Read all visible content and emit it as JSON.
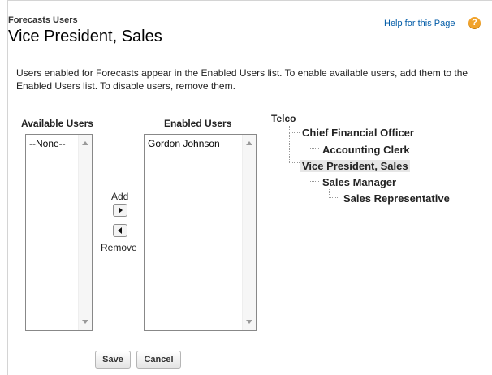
{
  "header": {
    "eyebrow": "Forecasts Users",
    "title": "Vice President, Sales",
    "help_link": "Help for this Page",
    "help_icon": "help-icon"
  },
  "description": "Users enabled for Forecasts appear in the Enabled Users list. To enable available users, add them to the Enabled Users list. To disable users, remove them.",
  "available": {
    "label": "Available Users",
    "options": [
      "--None--"
    ]
  },
  "enabled": {
    "label": "Enabled Users",
    "options": [
      "Gordon Johnson"
    ]
  },
  "move": {
    "add_label": "Add",
    "remove_label": "Remove"
  },
  "buttons": {
    "save": "Save",
    "cancel": "Cancel"
  },
  "tree": {
    "root": "Telco",
    "nodes": [
      "Chief Financial Officer",
      "Accounting Clerk",
      "Vice President, Sales",
      "Sales Manager",
      "Sales Representative"
    ],
    "selected": "Vice President, Sales"
  },
  "colors": {
    "link": "#015ba7",
    "help_icon": "#f1a32c",
    "selected_row": "#e6e6e6"
  }
}
